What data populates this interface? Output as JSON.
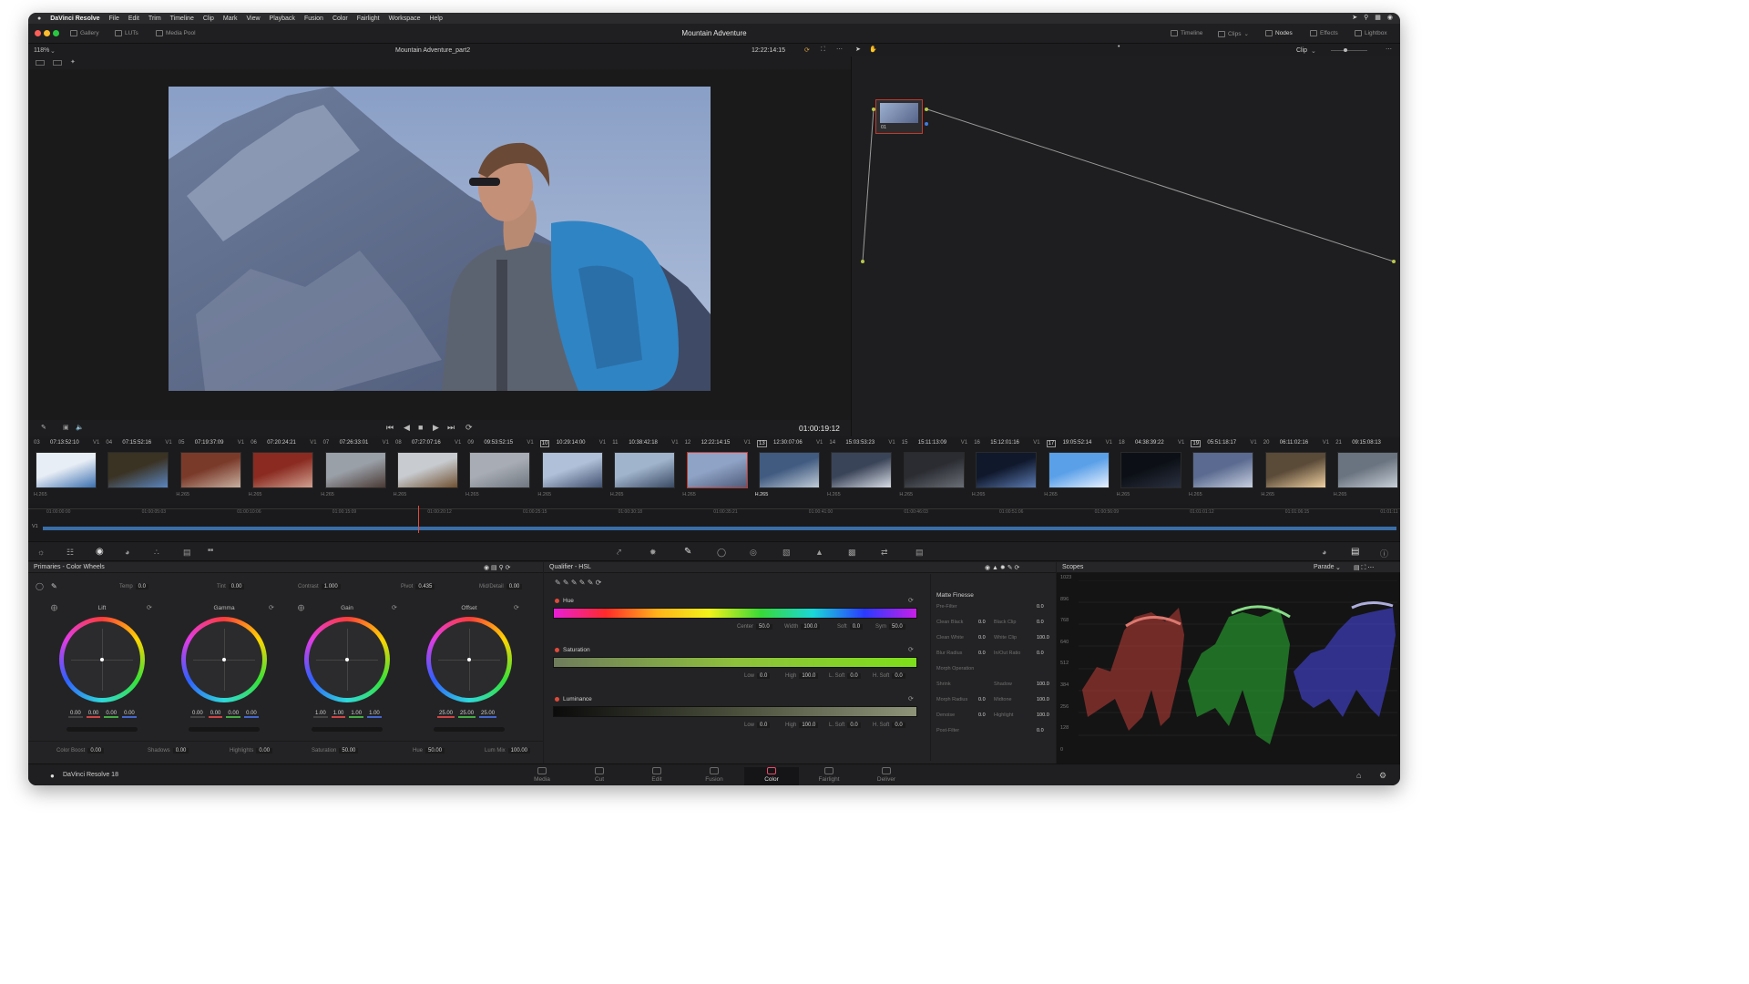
{
  "menubar": {
    "app": "DaVinci Resolve",
    "items": [
      "File",
      "Edit",
      "Trim",
      "Timeline",
      "Clip",
      "Mark",
      "View",
      "Playback",
      "Fusion",
      "Color",
      "Fairlight",
      "Workspace",
      "Help"
    ]
  },
  "toolbar": {
    "left": [
      "Gallery",
      "LUTs",
      "Media Pool"
    ],
    "title": "Mountain Adventure",
    "right": [
      "Timeline",
      "Clips",
      "Nodes",
      "Effects",
      "Lightbox"
    ]
  },
  "viewer": {
    "zoom": "118%",
    "clip_name": "Mountain Adventure_part2",
    "timecode_top": "12:22:14:15",
    "clip_mode": "Clip",
    "timecode": "01:00:19:12"
  },
  "node": {
    "label": "01"
  },
  "clips": [
    {
      "num": "03",
      "tc": "07:13:52:10",
      "track": "V1",
      "codec": "H.265"
    },
    {
      "num": "04",
      "tc": "07:15:52:16",
      "track": "V1",
      "codec": "H.265"
    },
    {
      "num": "05",
      "tc": "07:19:37:09",
      "track": "V1",
      "codec": "H.265"
    },
    {
      "num": "06",
      "tc": "07:20:24:21",
      "track": "V1",
      "codec": "H.265"
    },
    {
      "num": "07",
      "tc": "07:26:33:01",
      "track": "V1",
      "codec": "H.265"
    },
    {
      "num": "08",
      "tc": "07:27:07:16",
      "track": "V1",
      "codec": "H.265"
    },
    {
      "num": "09",
      "tc": "09:53:52:15",
      "track": "V1",
      "codec": "H.265"
    },
    {
      "num": "10",
      "tc": "10:29:14:00",
      "track": "V1",
      "codec": "H.265"
    },
    {
      "num": "11",
      "tc": "10:38:42:18",
      "track": "V1",
      "codec": "H.265"
    },
    {
      "num": "12",
      "tc": "12:22:14:15",
      "track": "V1",
      "codec": "H.265"
    },
    {
      "num": "13",
      "tc": "12:30:07:06",
      "track": "V1",
      "codec": "H.265"
    },
    {
      "num": "14",
      "tc": "15:03:53:23",
      "track": "V1",
      "codec": "H.265"
    },
    {
      "num": "15",
      "tc": "15:11:13:09",
      "track": "V1",
      "codec": "H.265"
    },
    {
      "num": "16",
      "tc": "15:12:01:16",
      "track": "V1",
      "codec": "H.265"
    },
    {
      "num": "17",
      "tc": "19:05:52:14",
      "track": "V1",
      "codec": "H.265"
    },
    {
      "num": "18",
      "tc": "04:38:39:22",
      "track": "V1",
      "codec": "H.265"
    },
    {
      "num": "19",
      "tc": "05:51:18:17",
      "track": "V1",
      "codec": "H.265"
    },
    {
      "num": "20",
      "tc": "06:11:02:16",
      "track": "V1",
      "codec": "H.265"
    },
    {
      "num": "21",
      "tc": "09:15:08:13",
      "track": "",
      "codec": "H.265"
    }
  ],
  "mini_timeline": {
    "ticks": [
      "01:00:00:00",
      "01:00:05:03",
      "01:00:10:06",
      "01:00:15:09",
      "01:00:20:12",
      "01:00:25:15",
      "01:00:30:18",
      "01:00:35:21",
      "01:00:41:00",
      "01:00:46:03",
      "01:00:51:06",
      "01:00:56:09",
      "01:01:01:12",
      "01:01:06:15",
      "01:01:11"
    ],
    "track": "V1",
    "playhead_fraction": 0.277
  },
  "primaries": {
    "title": "Primaries - Color Wheels",
    "top_params": [
      {
        "label": "Temp",
        "value": "0.0"
      },
      {
        "label": "Tint",
        "value": "0.00"
      },
      {
        "label": "Contrast",
        "value": "1.000"
      },
      {
        "label": "Pivot",
        "value": "0.435"
      },
      {
        "label": "Mid/Detail",
        "value": "0.00"
      }
    ],
    "wheels": [
      {
        "label": "Lift",
        "values": [
          "0.00",
          "0.00",
          "0.00",
          "0.00"
        ]
      },
      {
        "label": "Gamma",
        "values": [
          "0.00",
          "0.00",
          "0.00",
          "0.00"
        ]
      },
      {
        "label": "Gain",
        "values": [
          "1.00",
          "1.00",
          "1.00",
          "1.00"
        ]
      },
      {
        "label": "Offset",
        "values": [
          "25.00",
          "25.00",
          "25.00"
        ]
      }
    ],
    "bottom_params": [
      {
        "label": "Color Boost",
        "value": "0.00"
      },
      {
        "label": "Shadows",
        "value": "0.00"
      },
      {
        "label": "Highlights",
        "value": "0.00"
      },
      {
        "label": "Saturation",
        "value": "50.00"
      },
      {
        "label": "Hue",
        "value": "50.00"
      },
      {
        "label": "Lum Mix",
        "value": "100.00"
      }
    ]
  },
  "qualifier": {
    "title": "Qualifier - HSL",
    "hue": {
      "label": "Hue",
      "params": [
        {
          "label": "Center",
          "value": "50.0"
        },
        {
          "label": "Width",
          "value": "100.0"
        },
        {
          "label": "Soft",
          "value": "0.0"
        },
        {
          "label": "Sym",
          "value": "50.0"
        }
      ]
    },
    "saturation": {
      "label": "Saturation",
      "params": [
        {
          "label": "Low",
          "value": "0.0"
        },
        {
          "label": "High",
          "value": "100.0"
        },
        {
          "label": "L. Soft",
          "value": "0.0"
        },
        {
          "label": "H. Soft",
          "value": "0.0"
        }
      ]
    },
    "luminance": {
      "label": "Luminance",
      "params": [
        {
          "label": "Low",
          "value": "0.0"
        },
        {
          "label": "High",
          "value": "100.0"
        },
        {
          "label": "L. Soft",
          "value": "0.0"
        },
        {
          "label": "H. Soft",
          "value": "0.0"
        }
      ]
    }
  },
  "matte": {
    "title": "Matte Finesse",
    "rows": [
      {
        "a": "Pre-Filter",
        "av": "0.0"
      },
      {
        "a": "Clean Black",
        "av": "0.0",
        "b": "Black Clip",
        "bv": "0.0"
      },
      {
        "a": "Clean White",
        "av": "0.0",
        "b": "White Clip",
        "bv": "100.0"
      },
      {
        "a": "Blur Radius",
        "av": "0.0",
        "b": "In/Out Ratio",
        "bv": "0.0"
      },
      {
        "a": "Morph Operation"
      },
      {
        "a": "Shrink",
        "b": "Shadow",
        "bv": "100.0"
      },
      {
        "a": "Morph Radius",
        "av": "0.0",
        "b": "Midtone",
        "bv": "100.0"
      },
      {
        "a": "Denoise",
        "av": "0.0",
        "b": "Highlight",
        "bv": "100.0"
      },
      {
        "a": "Post-Filter",
        "av": "0.0"
      }
    ]
  },
  "scopes": {
    "title": "Scopes",
    "mode": "Parade",
    "ticks": [
      "1023",
      "896",
      "768",
      "640",
      "512",
      "384",
      "256",
      "128",
      "0"
    ]
  },
  "nav": {
    "items": [
      "Media",
      "Cut",
      "Edit",
      "Fusion",
      "Color",
      "Fairlight",
      "Deliver"
    ],
    "active": "Color",
    "brand": "DaVinci Resolve 18"
  },
  "colors": {
    "accent": "#c2392b",
    "active_page": "#e94b6a",
    "panel": "#232325"
  }
}
